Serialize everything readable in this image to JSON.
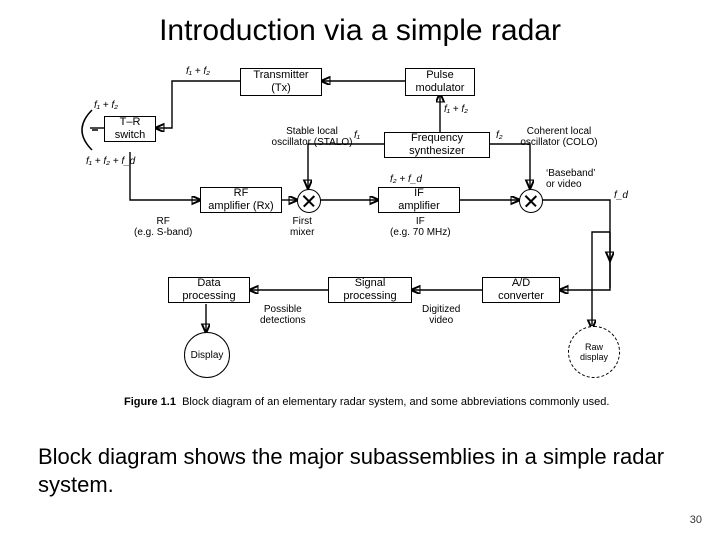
{
  "title": "Introduction via a simple radar",
  "footer_text": "Block diagram shows the major subassemblies in a simple radar system.",
  "page_number": "30",
  "figure_caption_label": "Figure 1.1",
  "figure_caption_text": "Block diagram of an elementary radar system, and some abbreviations commonly used.",
  "blocks": {
    "transmitter": "Transmitter\n(Tx)",
    "pulse_modulator": "Pulse\nmodulator",
    "tr_switch": "T–R\nswitch",
    "freq_synth": "Frequency\nsynthesizer",
    "rf_amp": "RF\namplifier (Rx)",
    "if_amp": "IF\namplifier",
    "ad_converter": "A/D\nconverter",
    "signal_proc": "Signal\nprocessing",
    "data_proc": "Data\nprocessing",
    "display": "Display",
    "raw_display": "Raw\ndisplay"
  },
  "labels": {
    "f1_plus_f2_top": "f₁ + f₂",
    "f1_plus_f2_left": "f₁ + f₂",
    "f1_plus_f2_mid": "f₁ + f₂",
    "f1_f2_fd": "f₁ + f₂ + f_d",
    "f1": "f₁",
    "f2": "f₂",
    "f2_fd": "f₂ + f_d",
    "fd": "f_d",
    "stalo": "Stable local\noscillator (STALO)",
    "colo": "Coherent local\noscillator (COLO)",
    "baseband": "‘Baseband’\nor video",
    "rf_band": "RF\n(e.g. S-band)",
    "first_mixer": "First\nmixer",
    "if_caption": "IF\n(e.g. 70 MHz)",
    "digitized_video": "Digitized\nvideo",
    "possible_detections": "Possible\ndetections"
  }
}
